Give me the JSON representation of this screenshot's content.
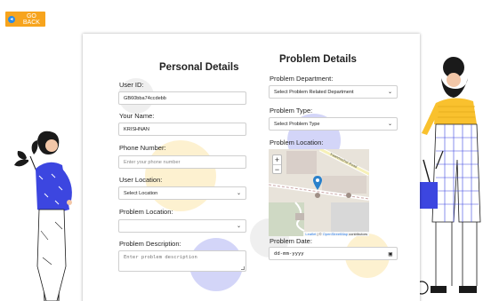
{
  "back_button": {
    "label": "GO BACK"
  },
  "personal": {
    "title": "Personal Details",
    "user_id_label": "User ID:",
    "user_id_value": "GB60bba74ccdebb",
    "name_label": "Your Name:",
    "name_value": "KRISHNAN",
    "phone_label": "Phone Number:",
    "phone_placeholder": "Enter your phone number",
    "user_location_label": "User Location:",
    "user_location_value": "Select Location",
    "problem_location_label": "Problem Location:",
    "problem_location_value": "",
    "description_label": "Problem Description:",
    "description_placeholder": "Enter problem description"
  },
  "problem": {
    "title": "Problem Details",
    "department_label": "Problem Department:",
    "department_value": "Select Problem Related Department",
    "type_label": "Problem Type:",
    "type_value": "Select Problem Type",
    "location_label": "Problem Location:",
    "map": {
      "zoom_in": "+",
      "zoom_out": "−",
      "road_label": "Kaanmazhai Road",
      "attribution_leaflet": "Leaflet",
      "attribution_sep": " | © ",
      "attribution_osm": "OpenStreetMap",
      "attribution_tail": " contributors"
    },
    "date_label": "Problem Date:",
    "date_placeholder": "dd-mm-yyyy"
  },
  "colors": {
    "accent": "#f7a41d",
    "map_marker": "#2a81cb",
    "illustration_blue": "#3c46e0",
    "illustration_yellow": "#f9c12e"
  },
  "icons": {
    "back": "arrow-left-circle-icon",
    "caret": "chevron-down-icon",
    "calendar": "calendar-icon",
    "marker": "map-marker-icon"
  }
}
